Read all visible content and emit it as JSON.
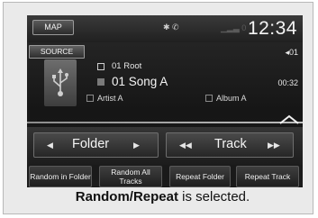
{
  "status_bar": {
    "map_label": "MAP",
    "clock": "12:34"
  },
  "source": {
    "button_label": "SOURCE",
    "track_number": "01"
  },
  "now_playing": {
    "folder": "01 Root",
    "song": "01 Song A",
    "elapsed": "00:32",
    "artist": "Artist A",
    "album": "Album A"
  },
  "nav": {
    "folder_label": "Folder",
    "track_label": "Track"
  },
  "modes": [
    {
      "label": "Random in Folder"
    },
    {
      "label": "Random All Tracks"
    },
    {
      "label": "Repeat Folder"
    },
    {
      "label": "Repeat Track"
    }
  ],
  "caption": {
    "bold": "Random/Repeat",
    "rest": " is selected."
  },
  "icons": {
    "status": "bluetooth-and-phone-icons",
    "usb": "usb-icon",
    "folder": "folder-icon",
    "song": "music-note-icon",
    "artist": "artist-icon",
    "album": "album-icon"
  }
}
